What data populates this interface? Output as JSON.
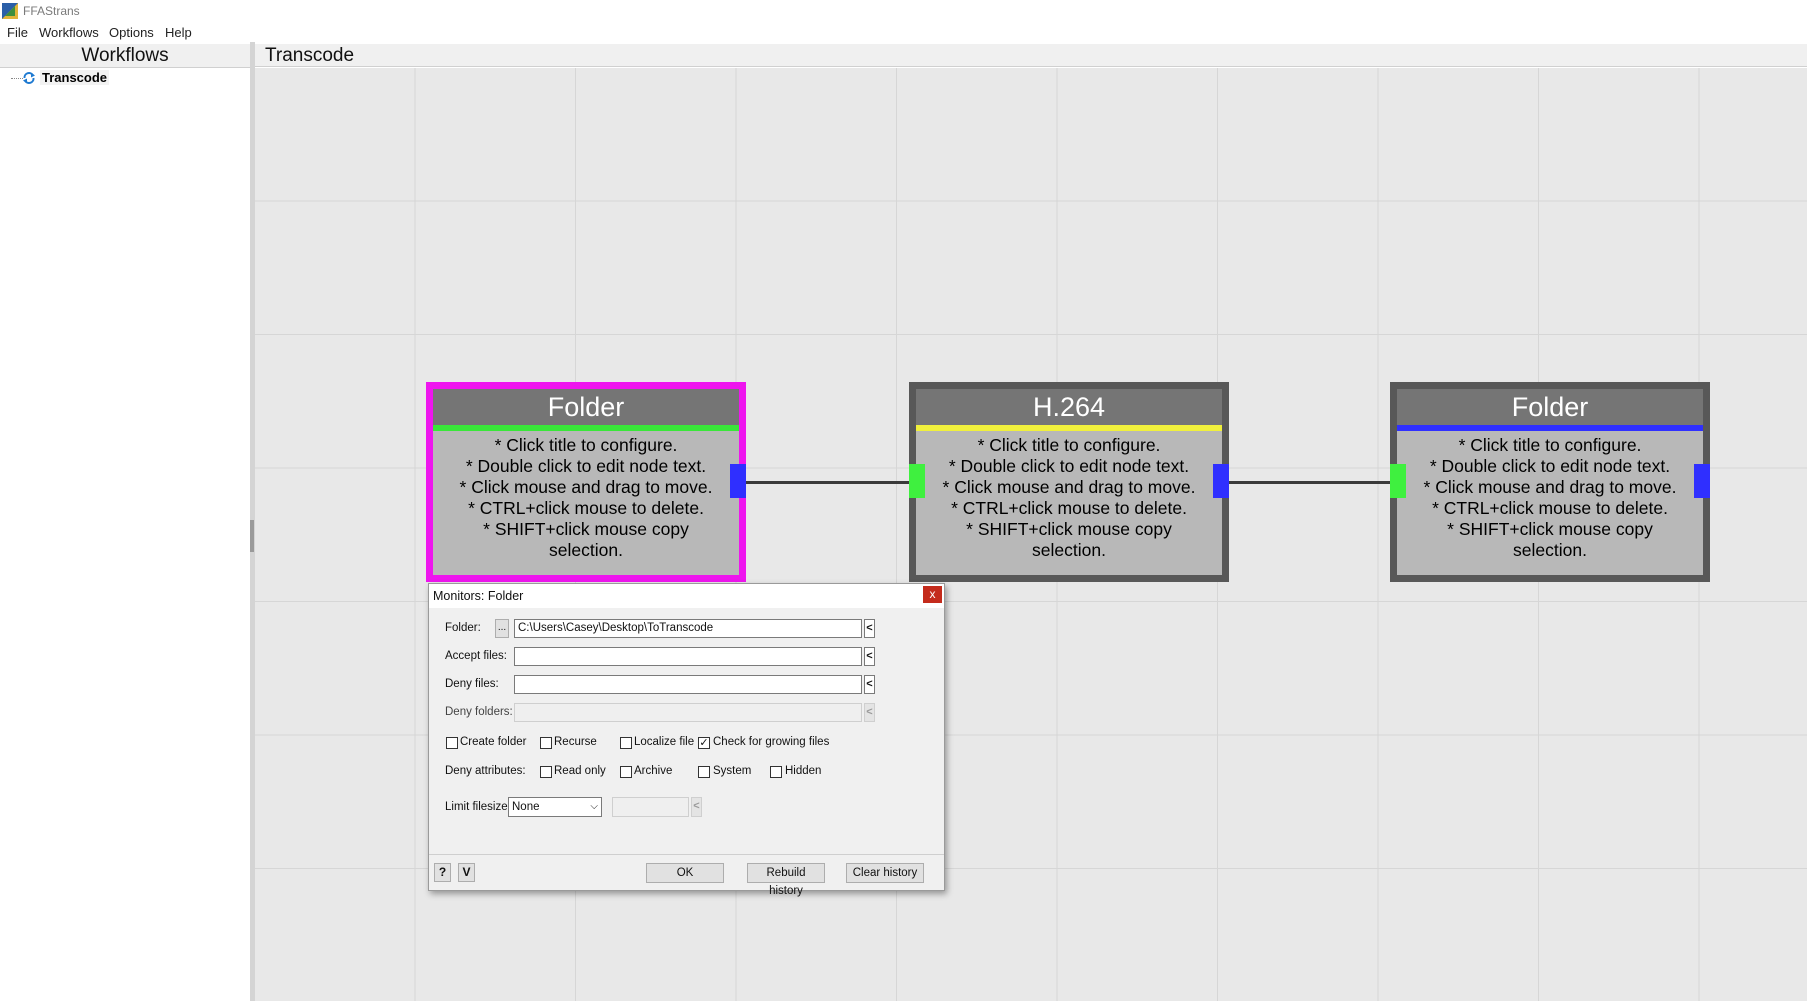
{
  "app": {
    "title": "FFAStrans"
  },
  "menu": [
    "File",
    "Workflows",
    "Options",
    "Help"
  ],
  "sidebar": {
    "header": "Workflows",
    "tree": [
      {
        "label": "Transcode",
        "icon": "refresh-icon"
      }
    ]
  },
  "canvas": {
    "header": "Transcode",
    "nodes": [
      {
        "title": "Folder",
        "bar_color": "#39e639",
        "selected": true,
        "lines": [
          "* Click title to configure.",
          "* Double click to edit node text.",
          "* Click mouse and drag to move.",
          "* CTRL+click mouse to delete.",
          "* SHIFT+click mouse copy",
          "selection."
        ]
      },
      {
        "title": "H.264",
        "bar_color": "#f0f03c",
        "selected": false,
        "lines": [
          "* Click title to configure.",
          "* Double click to edit node text.",
          "* Click mouse and drag to move.",
          "* CTRL+click mouse to delete.",
          "* SHIFT+click mouse copy",
          "selection."
        ]
      },
      {
        "title": "Folder",
        "bar_color": "#2f2fff",
        "selected": false,
        "lines": [
          "* Click title to configure.",
          "* Double click to edit node text.",
          "* Click mouse and drag to move.",
          "* CTRL+click mouse to delete.",
          "* SHIFT+click mouse copy",
          "selection."
        ]
      }
    ],
    "colors": {
      "selected_border": "#ee15ee",
      "input_port": "#3ff03f",
      "output_port": "#2f2fff"
    }
  },
  "dialog": {
    "title": "Monitors: Folder",
    "close": "x",
    "folder_label": "Folder:",
    "browse": "...",
    "folder_value": "C:\\Users\\Casey\\Desktop\\ToTranscode",
    "accept_label": "Accept files:",
    "accept_value": "",
    "deny_files_label": "Deny files:",
    "deny_files_value": "",
    "deny_folders_label": "Deny folders:",
    "deny_folders_value": "",
    "arrow": "<",
    "options": [
      {
        "label": "Create folder",
        "checked": false
      },
      {
        "label": "Recurse",
        "checked": false
      },
      {
        "label": "Localize file",
        "checked": false
      },
      {
        "label": "Check for growing files",
        "checked": true
      }
    ],
    "deny_attributes_label": "Deny attributes:",
    "attributes": [
      {
        "label": "Read only",
        "checked": false
      },
      {
        "label": "Archive",
        "checked": false
      },
      {
        "label": "System",
        "checked": false
      },
      {
        "label": "Hidden",
        "checked": false
      }
    ],
    "limit_label": "Limit filesize:",
    "limit_value": "None",
    "limit_size_value": "",
    "help_btn": "?",
    "v_btn": "V",
    "ok": "OK",
    "rebuild": "Rebuild history",
    "clear": "Clear history",
    "check_mark": "✓"
  }
}
